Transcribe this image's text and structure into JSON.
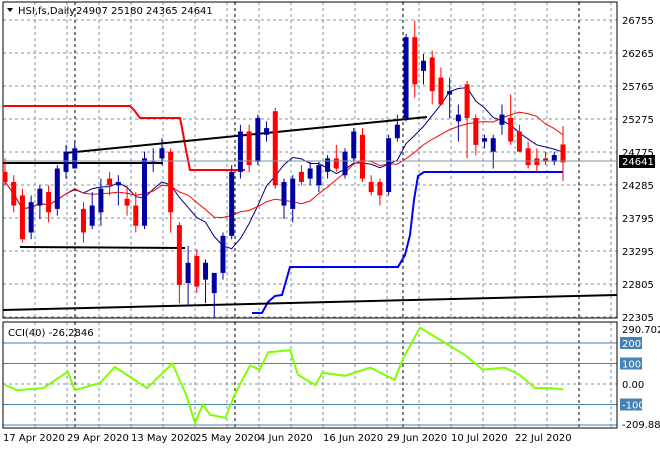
{
  "header": {
    "symbol": "HSI,fs,Daily",
    "ohlc": "24907 25180 24365 24641"
  },
  "price_axis": {
    "labels": [
      "26755",
      "26265",
      "25765",
      "25275",
      "24775",
      "24285",
      "23795",
      "23295",
      "22805",
      "22305"
    ],
    "current": "24641"
  },
  "indicator": {
    "title": "CCI(40) -26.2846",
    "max_label": "290.7027",
    "min_label": "-209.886",
    "levels": [
      "200",
      "100",
      "0.00",
      "-100"
    ]
  },
  "dates": [
    "17 Apr 2020",
    "29 Apr 2020",
    "13 May 2020",
    "25 May 2020",
    "4 Jun 2020",
    "16 Jun 2020",
    "29 Jun 2020",
    "10 Jul 2020",
    "22 Jul 2020"
  ],
  "colors": {
    "bull": "#0000a0",
    "bear": "#ff0000",
    "cci": "#80ff00",
    "ma_fast": "#000080",
    "ma_slow": "#ff0000",
    "support": "#0000ff"
  },
  "chart_data": {
    "type": "candlestick",
    "ylim": [
      22305,
      26755
    ],
    "candles": [
      [
        24500,
        24700,
        24300,
        24350
      ],
      [
        24350,
        24450,
        23900,
        24000
      ],
      [
        24150,
        24250,
        23450,
        23500
      ],
      [
        23600,
        24150,
        23500,
        24050
      ],
      [
        24000,
        24300,
        23800,
        24250
      ],
      [
        24200,
        24300,
        23750,
        23900
      ],
      [
        23950,
        24600,
        23850,
        24550
      ],
      [
        24500,
        24900,
        24400,
        24800
      ],
      [
        24550,
        24950,
        24550,
        24850
      ],
      [
        23950,
        24050,
        23450,
        23600
      ],
      [
        23700,
        24200,
        23650,
        24000
      ],
      [
        23900,
        24400,
        23700,
        24250
      ],
      [
        24400,
        24500,
        24150,
        24300
      ],
      [
        24300,
        24450,
        24000,
        24350
      ],
      [
        24100,
        24300,
        23850,
        24000
      ],
      [
        24000,
        24200,
        23600,
        23700
      ],
      [
        23700,
        24800,
        23650,
        24700
      ],
      [
        24650,
        24850,
        24500,
        24650
      ],
      [
        24700,
        25000,
        24600,
        24850
      ],
      [
        24800,
        24850,
        23600,
        23900
      ],
      [
        23710,
        23750,
        22550,
        22820
      ],
      [
        22850,
        23400,
        22500,
        23150
      ],
      [
        23250,
        23350,
        22700,
        22800
      ],
      [
        22900,
        23200,
        22550,
        23150
      ],
      [
        22700,
        23000,
        22350,
        23000
      ],
      [
        23000,
        23600,
        22900,
        23550
      ],
      [
        23550,
        24600,
        23500,
        24500
      ],
      [
        24500,
        25200,
        24400,
        25100
      ],
      [
        25100,
        25200,
        24500,
        24600
      ],
      [
        24650,
        25350,
        24600,
        25300
      ],
      [
        25050,
        25250,
        24950,
        25150
      ],
      [
        25400,
        25450,
        24250,
        24300
      ],
      [
        24000,
        24400,
        23800,
        24350
      ],
      [
        23950,
        24450,
        23750,
        24400
      ],
      [
        24500,
        24600,
        24300,
        24350
      ],
      [
        24400,
        24650,
        24300,
        24550
      ],
      [
        24300,
        24650,
        24200,
        24600
      ],
      [
        24500,
        24750,
        24400,
        24700
      ],
      [
        24700,
        24900,
        24500,
        24550
      ],
      [
        24450,
        24850,
        24400,
        24800
      ],
      [
        24700,
        25150,
        24650,
        25100
      ],
      [
        25050,
        25150,
        24350,
        24400
      ],
      [
        24350,
        24450,
        24150,
        24200
      ],
      [
        24350,
        24400,
        24000,
        24150
      ],
      [
        24200,
        25050,
        24150,
        25000
      ],
      [
        25000,
        25350,
        24950,
        25200
      ],
      [
        25300,
        26550,
        25250,
        26500
      ],
      [
        26500,
        26750,
        25600,
        25800
      ],
      [
        26000,
        26250,
        25800,
        26150
      ],
      [
        26200,
        26300,
        25500,
        25700
      ],
      [
        25900,
        26050,
        25500,
        25500
      ],
      [
        25650,
        25900,
        25300,
        25700
      ],
      [
        25250,
        25500,
        24950,
        25350
      ],
      [
        25800,
        25850,
        24700,
        25300
      ],
      [
        25300,
        25350,
        24750,
        24900
      ],
      [
        24950,
        25050,
        24850,
        25000
      ],
      [
        24800,
        25050,
        24550,
        25000
      ],
      [
        25200,
        25500,
        25050,
        25350
      ],
      [
        25300,
        25650,
        24900,
        24950
      ],
      [
        25100,
        25200,
        24800,
        24800
      ],
      [
        24850,
        24950,
        24550,
        24600
      ],
      [
        24700,
        24850,
        24500,
        24600
      ],
      [
        24700,
        24800,
        24600,
        24650
      ],
      [
        24650,
        24800,
        24600,
        24750
      ],
      [
        24907,
        25180,
        24365,
        24641
      ]
    ],
    "cci_points": [
      [
        0,
        -5
      ],
      [
        1.4,
        -30
      ],
      [
        4.4,
        -20
      ],
      [
        7.2,
        60
      ],
      [
        8,
        -30
      ],
      [
        10.9,
        5
      ],
      [
        12.6,
        83
      ],
      [
        16.3,
        -20
      ],
      [
        19.2,
        100
      ],
      [
        20.8,
        -55
      ],
      [
        21.8,
        -190
      ],
      [
        22.7,
        -100
      ],
      [
        23.5,
        -150
      ],
      [
        25.3,
        -165
      ],
      [
        26.3,
        -55
      ],
      [
        28.1,
        90
      ],
      [
        29.2,
        70
      ],
      [
        30.2,
        155
      ],
      [
        32.7,
        165
      ],
      [
        33.6,
        45
      ],
      [
        35.6,
        -5
      ],
      [
        36.4,
        55
      ],
      [
        39,
        40
      ],
      [
        41.9,
        80
      ],
      [
        44.7,
        20
      ],
      [
        45.6,
        120
      ],
      [
        47.6,
        275
      ],
      [
        50.5,
        200
      ],
      [
        52.8,
        140
      ],
      [
        54.8,
        70
      ],
      [
        57.3,
        80
      ],
      [
        59,
        45
      ],
      [
        60.8,
        -20
      ],
      [
        62.5,
        -20
      ],
      [
        64,
        -26.28
      ]
    ],
    "cci_ylim": [
      -209.886,
      290.7027
    ]
  }
}
